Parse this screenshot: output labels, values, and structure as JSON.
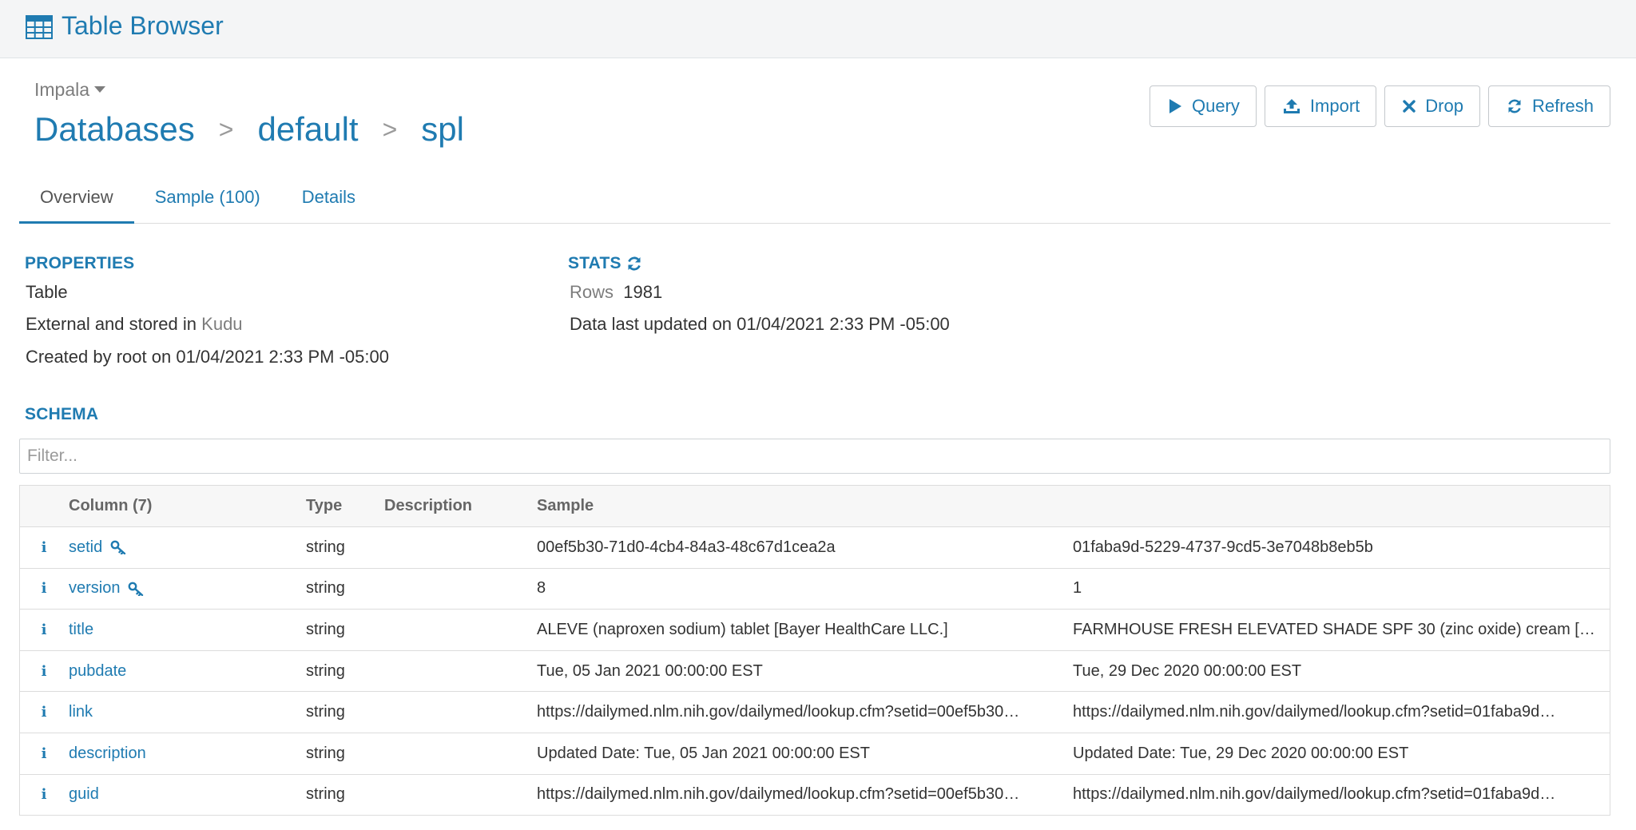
{
  "header": {
    "title": "Table Browser",
    "icon": "table-icon"
  },
  "engine": {
    "label": "Impala"
  },
  "breadcrumb": {
    "databases": "Databases",
    "database": "default",
    "table": "spl",
    "separator": ">"
  },
  "actions": {
    "query": "Query",
    "import": "Import",
    "drop": "Drop",
    "refresh": "Refresh"
  },
  "tabs": {
    "overview": "Overview",
    "sample": "Sample (100)",
    "details": "Details"
  },
  "properties": {
    "title": "PROPERTIES",
    "type": "Table",
    "storage_prefix": "External and stored in",
    "storage_engine": "Kudu",
    "created": "Created by root on 01/04/2021 2:33 PM -05:00"
  },
  "stats": {
    "title": "STATS",
    "rows_label": "Rows",
    "rows_value": "1981",
    "last_updated": "Data last updated on 01/04/2021 2:33 PM -05:00"
  },
  "schema": {
    "title": "SCHEMA",
    "filter_placeholder": "Filter...",
    "headers": {
      "column": "Column (7)",
      "type": "Type",
      "description": "Description",
      "sample": "Sample"
    },
    "rows": [
      {
        "name": "setid",
        "type": "string",
        "description": "",
        "sample1": "00ef5b30-71d0-4cb4-84a3-48c67d1cea2a",
        "sample2": "01faba9d-5229-4737-9cd5-3e7048b8eb5b",
        "key": true
      },
      {
        "name": "version",
        "type": "string",
        "description": "",
        "sample1": "8",
        "sample2": "1",
        "key": true
      },
      {
        "name": "title",
        "type": "string",
        "description": "",
        "sample1": "ALEVE (naproxen sodium) tablet [Bayer HealthCare LLC.]",
        "sample2": "FARMHOUSE FRESH ELEVATED SHADE SPF 30 (zinc oxide) cream […",
        "key": false
      },
      {
        "name": "pubdate",
        "type": "string",
        "description": "",
        "sample1": "Tue, 05 Jan 2021 00:00:00 EST",
        "sample2": "Tue, 29 Dec 2020 00:00:00 EST",
        "key": false
      },
      {
        "name": "link",
        "type": "string",
        "description": "",
        "sample1": "https://dailymed.nlm.nih.gov/dailymed/lookup.cfm?setid=00ef5b30…",
        "sample2": "https://dailymed.nlm.nih.gov/dailymed/lookup.cfm?setid=01faba9d…",
        "key": false
      },
      {
        "name": "description",
        "type": "string",
        "description": "",
        "sample1": "Updated Date: Tue, 05 Jan 2021 00:00:00 EST",
        "sample2": "Updated Date: Tue, 29 Dec 2020 00:00:00 EST",
        "key": false
      },
      {
        "name": "guid",
        "type": "string",
        "description": "",
        "sample1": "https://dailymed.nlm.nih.gov/dailymed/lookup.cfm?setid=00ef5b30…",
        "sample2": "https://dailymed.nlm.nih.gov/dailymed/lookup.cfm?setid=01faba9d…",
        "key": false
      }
    ]
  },
  "colors": {
    "accent": "#1f7bb1",
    "muted": "#7d7d7d",
    "border": "#dcdcdc"
  }
}
